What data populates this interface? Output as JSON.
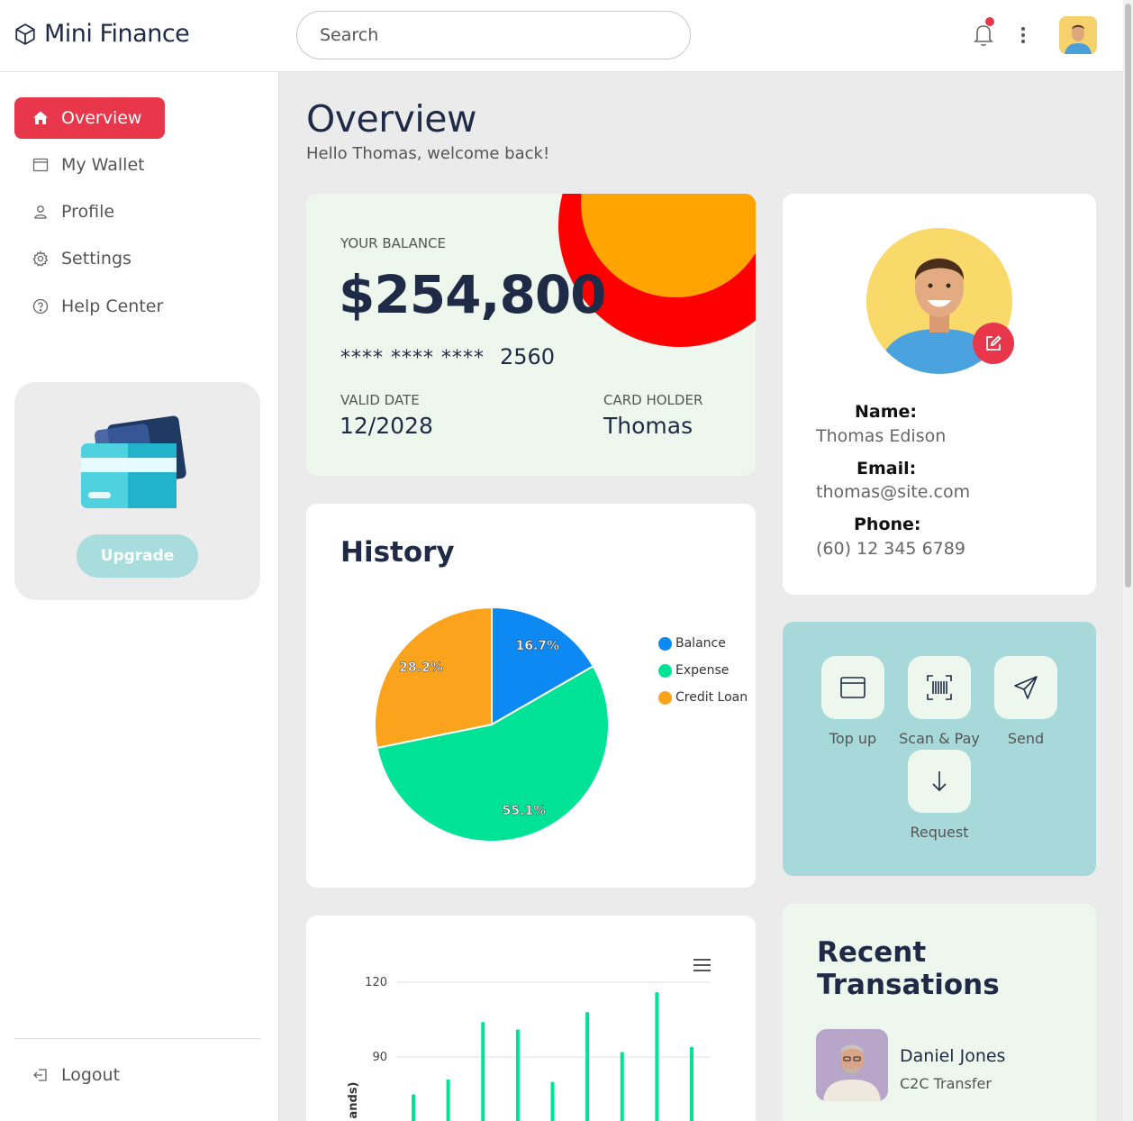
{
  "app": {
    "name": "Mini Finance"
  },
  "search": {
    "placeholder": "Search"
  },
  "sidebar": {
    "items": [
      {
        "label": "Overview",
        "icon": "home-icon",
        "active": true
      },
      {
        "label": "My Wallet",
        "icon": "wallet-icon"
      },
      {
        "label": "Profile",
        "icon": "user-icon"
      },
      {
        "label": "Settings",
        "icon": "gear-icon"
      },
      {
        "label": "Help Center",
        "icon": "help-icon"
      }
    ],
    "upgrade_label": "Upgrade",
    "logout_label": "Logout"
  },
  "page": {
    "title": "Overview",
    "subtitle": "Hello Thomas, welcome back!"
  },
  "balance": {
    "label": "YOUR BALANCE",
    "amount": "$254,800",
    "masked": "****  ****  ****",
    "last4": "2560",
    "valid_label": "VALID DATE",
    "valid_value": "12/2028",
    "holder_label": "CARD HOLDER",
    "holder_value": "Thomas"
  },
  "profile": {
    "name_label": "Name:",
    "name_value": "Thomas Edison",
    "email_label": "Email:",
    "email_value": "thomas@site.com",
    "phone_label": "Phone:",
    "phone_value": "(60) 12 345 6789"
  },
  "history": {
    "title": "History",
    "chart_data": {
      "type": "pie",
      "labels": [
        "Balance",
        "Expense",
        "Credit Loan"
      ],
      "values": [
        16.7,
        55.1,
        28.2
      ],
      "value_labels": [
        "16.7%",
        "55.1%",
        "28.2%"
      ],
      "colors": [
        "#0c89f2",
        "#00e396",
        "#fba31d"
      ],
      "legend": "right"
    }
  },
  "actions": [
    {
      "label": "Top up",
      "icon": "wallet-icon"
    },
    {
      "label": "Scan & Pay",
      "icon": "barcode-icon"
    },
    {
      "label": "Send",
      "icon": "send-icon"
    },
    {
      "label": "Request",
      "icon": "arrow-down-icon"
    }
  ],
  "bar_chart": {
    "chart_data": {
      "type": "bar",
      "y_ticks": [
        "120",
        "90"
      ],
      "ylabel_fragment": "ands)",
      "ylim": [
        0,
        120
      ],
      "values": [
        75,
        81,
        104,
        101,
        80,
        108,
        92,
        116,
        94
      ],
      "color": "#00e396",
      "grid": true
    }
  },
  "recent": {
    "title": "Recent Transations",
    "items": [
      {
        "name": "Daniel Jones",
        "type": "C2C Transfer"
      }
    ]
  }
}
